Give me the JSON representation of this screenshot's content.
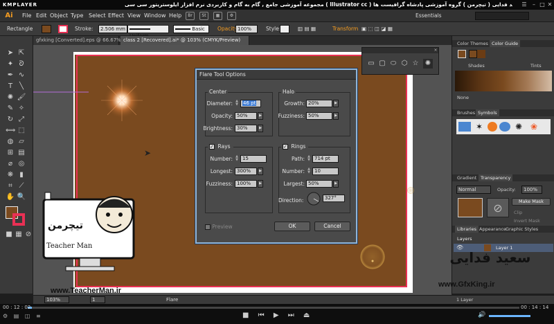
{
  "player": {
    "logo": "KMPLAYER",
    "title": "مجموعه آموزشی جامع , گام به گام و کاربردی نرم افزار ایلوستریتور سی سی ( Illustrator cc )  مدرس : سعید فدایی ( تیچرمن ) گروه آموزشی پادشاه گرافیست ها",
    "time_current": "00 : 12 : 02",
    "time_total": "00 : 14 : 14"
  },
  "menu": {
    "app_logo": "Ai",
    "items": [
      "File",
      "Edit",
      "Object",
      "Type",
      "Select",
      "Effect",
      "View",
      "Window",
      "Help"
    ],
    "icon_br": "Br",
    "icon_st": "St",
    "workspace": "Essentials"
  },
  "control": {
    "selection": "Rectangle",
    "stroke_label": "Stroke:",
    "stroke_value": "2.506 mm",
    "profile_1": "Uniform",
    "profile_2": "Basic",
    "opacity_label": "Opacity:",
    "opacity_value": "100%",
    "style_label": "Style:",
    "transform_label": "Transform",
    "fill_color": "#7a4a1f",
    "stroke_color": "#e93054"
  },
  "tabs": [
    "gfxking [Converted].eps @ 66.67% (RGB/Preview)",
    "class 2 [Recovered].ai* @ 103% (CMYK/Preview)"
  ],
  "dialog": {
    "title": "Flare Tool Options",
    "center": {
      "title": "Center",
      "diameter_label": "Diameter:",
      "diameter": "46 pt",
      "opacity_label": "Opacity:",
      "opacity": "50%",
      "brightness_label": "Brightness:",
      "brightness": "30%"
    },
    "halo": {
      "title": "Halo",
      "growth_label": "Growth:",
      "growth": "20%",
      "fuzziness_label": "Fuzziness:",
      "fuzziness": "50%"
    },
    "rays": {
      "title": "Rays",
      "number_label": "Number:",
      "number": "15",
      "longest_label": "Longest:",
      "longest": "300%",
      "fuzziness_label": "Fuzziness:",
      "fuzziness": "100%"
    },
    "rings": {
      "title": "Rings",
      "path_label": "Path:",
      "path": "714 pt",
      "number_label": "Number:",
      "number": "10",
      "largest_label": "Largest:",
      "largest": "50%",
      "direction_label": "Direction:",
      "direction": "327°"
    },
    "preview_label": "Preview",
    "ok_label": "OK",
    "cancel_label": "Cancel"
  },
  "panels": {
    "color_themes": "Color Themes",
    "color_guide": "Color Guide",
    "shades": "Shades",
    "tints": "Tints",
    "none": "None",
    "brushes": "Brushes",
    "symbols": "Symbols",
    "gradient": "Gradient",
    "transparency": "Transparency",
    "blend_mode": "Normal",
    "opacity_label": "Opacity:",
    "opacity_value": "100%",
    "make_mask": "Make Mask",
    "clip": "Clip",
    "invert_mask": "Invert Mask",
    "libraries": "Libraries",
    "appearance": "Appearance",
    "graphic_styles": "Graphic Styles",
    "layers": "Layers",
    "layer_name": "Layer 1",
    "layer_count": "1 Layer"
  },
  "status": {
    "zoom": "103%",
    "page": "1",
    "tool": "Flare"
  },
  "watermark": {
    "brand_fa": "تیچرمن",
    "brand_en": "Teacher Man",
    "site_left": "www.TeacherMan.ir",
    "name_fa": "سعید فدایی",
    "site_right": "www.GfxKing.ir"
  },
  "colors": {
    "artboard_fill": "#7a4a1f",
    "bleed": "#e93054",
    "dialog_border": "#8fb4d8",
    "ai_orange": "#f49c21"
  }
}
